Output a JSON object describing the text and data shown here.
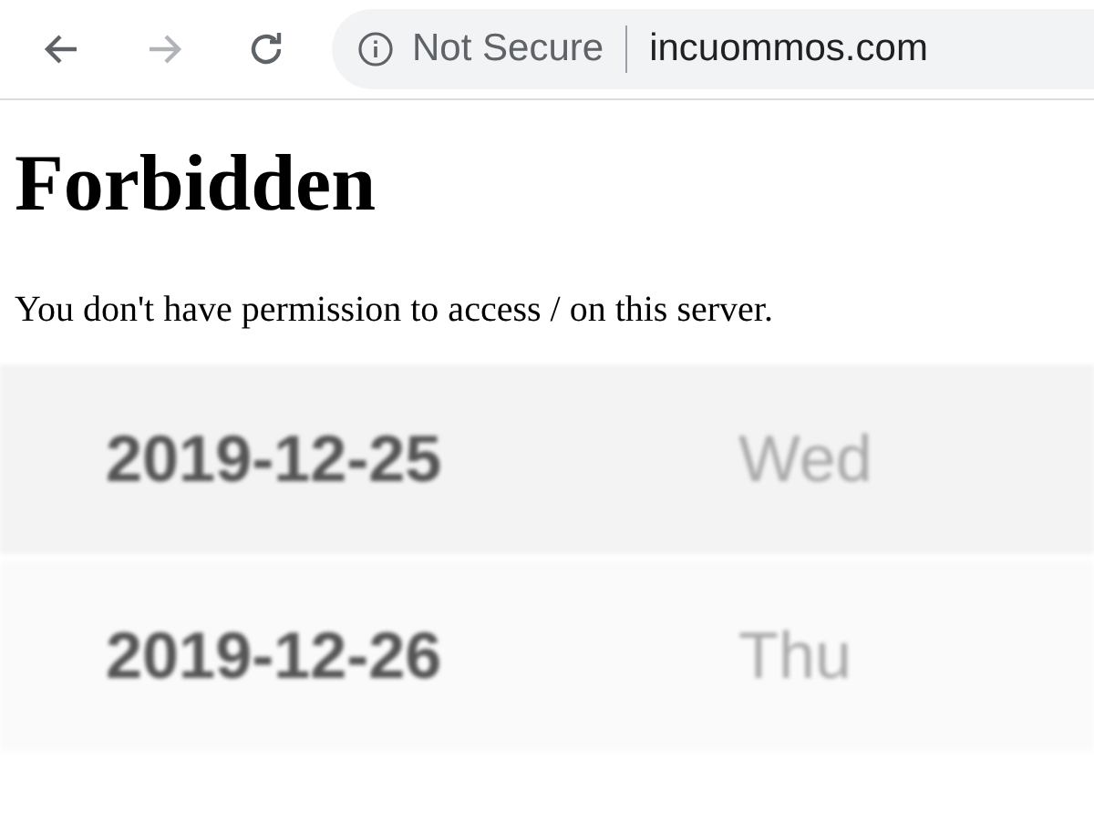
{
  "toolbar": {
    "nav_buttons": [
      {
        "kind": "back",
        "disabled": false
      },
      {
        "kind": "forward",
        "disabled": true
      },
      {
        "kind": "reload",
        "disabled": false
      }
    ],
    "security_label": "Not Secure",
    "url": "incuommos.com"
  },
  "page": {
    "heading": "Forbidden",
    "message": "You don't have permission to access / on this server."
  },
  "rows": [
    {
      "date": "2019-12-25",
      "day": "Wed"
    },
    {
      "date": "2019-12-26",
      "day": "Thu"
    }
  ]
}
